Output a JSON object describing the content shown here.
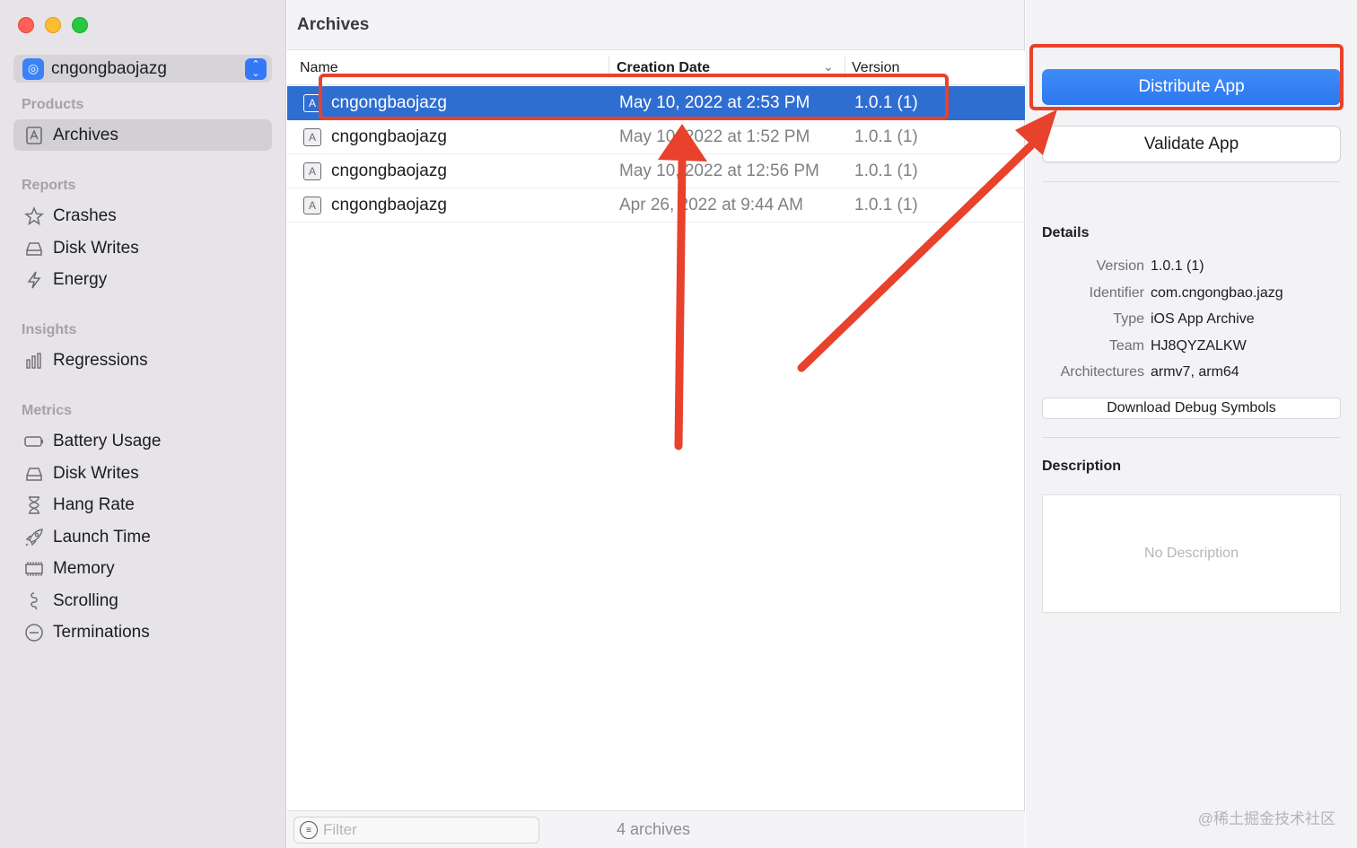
{
  "window": {
    "project_name": "cngongbaojazg"
  },
  "sidebar": {
    "sections": {
      "products": "Products",
      "reports": "Reports",
      "insights": "Insights",
      "metrics": "Metrics"
    },
    "products": [
      {
        "label": "Archives",
        "icon": "archive-icon",
        "active": true
      }
    ],
    "reports": [
      {
        "label": "Crashes",
        "icon": "crash-star-icon"
      },
      {
        "label": "Disk Writes",
        "icon": "disk-icon"
      },
      {
        "label": "Energy",
        "icon": "bolt-icon"
      }
    ],
    "insights": [
      {
        "label": "Regressions",
        "icon": "bar-chart-icon"
      }
    ],
    "metrics": [
      {
        "label": "Battery Usage",
        "icon": "battery-icon"
      },
      {
        "label": "Disk Writes",
        "icon": "disk-icon"
      },
      {
        "label": "Hang Rate",
        "icon": "hourglass-icon"
      },
      {
        "label": "Launch Time",
        "icon": "rocket-icon"
      },
      {
        "label": "Memory",
        "icon": "memory-chip-icon"
      },
      {
        "label": "Scrolling",
        "icon": "scroll-icon"
      },
      {
        "label": "Terminations",
        "icon": "minus-circle-icon"
      }
    ]
  },
  "archives": {
    "title": "Archives",
    "columns": {
      "name": "Name",
      "creation_date": "Creation Date",
      "version": "Version"
    },
    "rows": [
      {
        "name": "cngongbaojazg",
        "date": "May 10, 2022 at 2:53 PM",
        "version": "1.0.1 (1)",
        "selected": true
      },
      {
        "name": "cngongbaojazg",
        "date": "May 10, 2022 at 1:52 PM",
        "version": "1.0.1 (1)",
        "selected": false
      },
      {
        "name": "cngongbaojazg",
        "date": "May 10, 2022 at 12:56 PM",
        "version": "1.0.1 (1)",
        "selected": false
      },
      {
        "name": "cngongbaojazg",
        "date": "Apr 26, 2022 at 9:44 AM",
        "version": "1.0.1 (1)",
        "selected": false
      }
    ],
    "filter_placeholder": "Filter",
    "count": "4 archives"
  },
  "inspector": {
    "distribute_label": "Distribute App",
    "validate_label": "Validate App",
    "details_heading": "Details",
    "details": [
      {
        "key": "Version",
        "value": "1.0.1 (1)"
      },
      {
        "key": "Identifier",
        "value": "com.cngongbao.jazg"
      },
      {
        "key": "Type",
        "value": "iOS App Archive"
      },
      {
        "key": "Team",
        "value": "HJ8QYZALKW"
      },
      {
        "key": "Architectures",
        "value": "armv7, arm64"
      }
    ],
    "download_symbols_label": "Download Debug Symbols",
    "description_heading": "Description",
    "description_placeholder": "No Description"
  },
  "watermark": "@稀土掘金技术社区",
  "colors": {
    "accent": "#2f6ed1",
    "annotation": "#e8412c"
  }
}
